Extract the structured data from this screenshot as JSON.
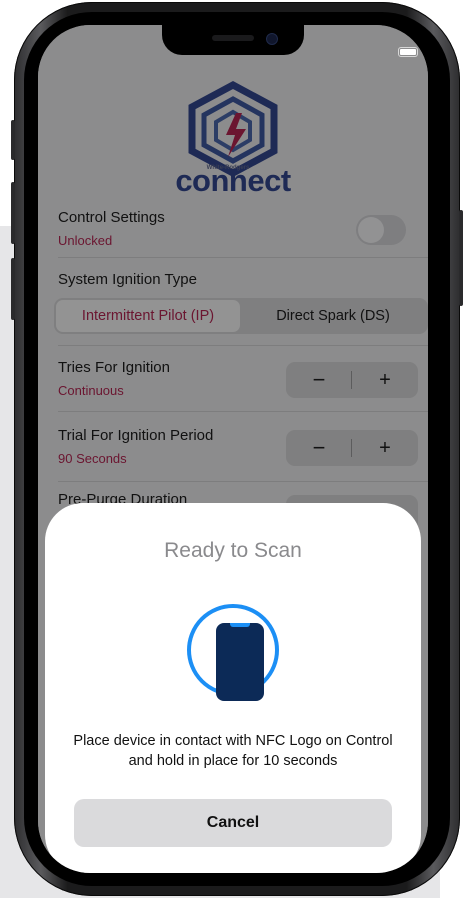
{
  "logo": {
    "brand_small": "White-Rodgers",
    "brand_word": "connect"
  },
  "control_settings": {
    "label": "Control Settings",
    "status": "Unlocked"
  },
  "ignition_type": {
    "label": "System Ignition Type",
    "options": [
      "Intermittent Pilot (IP)",
      "Direct Spark (DS)"
    ],
    "selected": "Intermittent Pilot (IP)"
  },
  "tries_for_ignition": {
    "label": "Tries For Ignition",
    "value": "Continuous"
  },
  "trial_period": {
    "label": "Trial For Ignition Period",
    "value": "90 Seconds"
  },
  "pre_purge": {
    "label": "Pre-Purge Duration"
  },
  "stepper": {
    "minus": "−",
    "plus": "+"
  },
  "nfc_sheet": {
    "title": "Ready to Scan",
    "message": "Place device in contact with NFC Logo on Control and hold in place for 10 seconds",
    "cancel_label": "Cancel"
  },
  "colors": {
    "accent_red": "#6b1530",
    "nfc_blue": "#1c8ff5",
    "nfc_phone": "#0c2a57"
  }
}
